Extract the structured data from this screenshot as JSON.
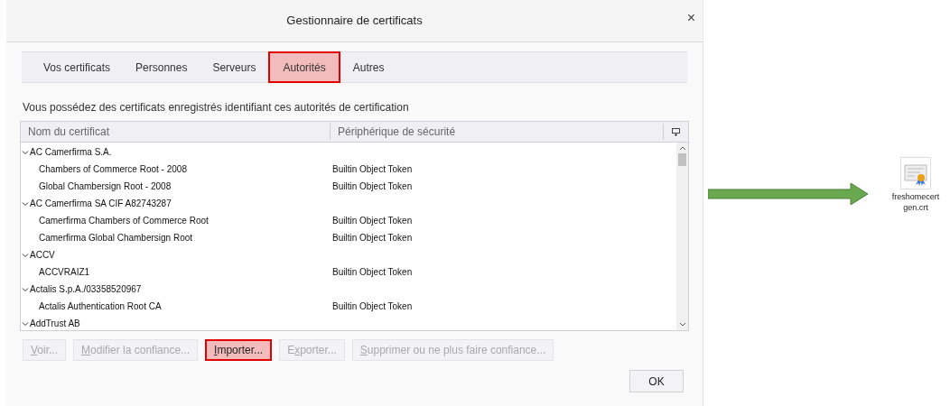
{
  "window": {
    "title": "Gestionnaire de certificats",
    "close": "×"
  },
  "tabs": [
    {
      "label": "Vos certificats",
      "selected": false,
      "highlighted": false
    },
    {
      "label": "Personnes",
      "selected": false,
      "highlighted": false
    },
    {
      "label": "Serveurs",
      "selected": false,
      "highlighted": false
    },
    {
      "label": "Autorités",
      "selected": true,
      "highlighted": true
    },
    {
      "label": "Autres",
      "selected": false,
      "highlighted": false
    }
  ],
  "description": "Vous possédez des certificats enregistrés identifiant ces autorités de certification",
  "table": {
    "columns": [
      "Nom du certificat",
      "Périphérique de sécurité"
    ],
    "groups": [
      {
        "name": "AC Camerfirma S.A.",
        "expanded": true,
        "children": [
          {
            "name": "Chambers of Commerce Root - 2008",
            "device": "Builtin Object Token"
          },
          {
            "name": "Global Chambersign Root - 2008",
            "device": "Builtin Object Token"
          }
        ]
      },
      {
        "name": "AC Camerfirma SA CIF A82743287",
        "expanded": true,
        "children": [
          {
            "name": "Camerfirma Chambers of Commerce Root",
            "device": "Builtin Object Token"
          },
          {
            "name": "Camerfirma Global Chambersign Root",
            "device": "Builtin Object Token"
          }
        ]
      },
      {
        "name": "ACCV",
        "expanded": true,
        "children": [
          {
            "name": "ACCVRAIZ1",
            "device": "Builtin Object Token"
          }
        ]
      },
      {
        "name": "Actalis S.p.A./03358520967",
        "expanded": true,
        "children": [
          {
            "name": "Actalis Authentication Root CA",
            "device": "Builtin Object Token"
          }
        ]
      },
      {
        "name": "AddTrust AB",
        "expanded": true
      }
    ]
  },
  "buttons": [
    {
      "segments": [
        {
          "text": "V",
          "underlined": true
        },
        {
          "text": "oir...",
          "underlined": false
        }
      ],
      "disabled": true,
      "highlighted": false
    },
    {
      "segments": [
        {
          "text": "M",
          "underlined": true
        },
        {
          "text": "odifier la confiance...",
          "underlined": false
        }
      ],
      "disabled": true,
      "highlighted": false
    },
    {
      "segments": [
        {
          "text": "I",
          "underlined": true
        },
        {
          "text": "mporter...",
          "underlined": false
        }
      ],
      "disabled": false,
      "highlighted": true
    },
    {
      "segments": [
        {
          "text": "E",
          "underlined": false
        },
        {
          "text": "x",
          "underlined": true
        },
        {
          "text": "porter...",
          "underlined": false
        }
      ],
      "disabled": true,
      "highlighted": false
    },
    {
      "segments": [
        {
          "text": "S",
          "underlined": true
        },
        {
          "text": "upprimer ou ne plus faire confiance...",
          "underlined": false
        }
      ],
      "disabled": true,
      "highlighted": false
    }
  ],
  "ok_button": "OK",
  "file": {
    "name": "freshomecert gen.crt"
  }
}
